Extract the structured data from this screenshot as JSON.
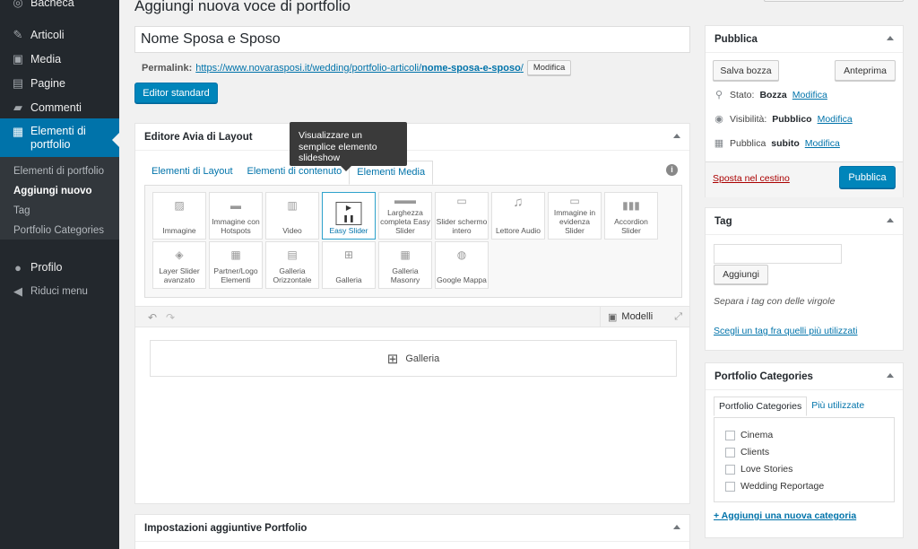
{
  "sidebar": {
    "items": [
      {
        "label": "Bacheca",
        "icon": "dashboard-icon"
      },
      {
        "label": "Articoli",
        "icon": "pin-icon"
      },
      {
        "label": "Media",
        "icon": "media-icon"
      },
      {
        "label": "Pagine",
        "icon": "page-icon"
      },
      {
        "label": "Commenti",
        "icon": "comment-icon"
      },
      {
        "label": "Elementi di portfolio",
        "icon": "portfolio-icon"
      },
      {
        "label": "Profilo",
        "icon": "user-icon"
      },
      {
        "label": "Riduci menu",
        "icon": "collapse-icon"
      }
    ],
    "submenu": [
      "Elementi di portfolio",
      "Aggiungi nuovo",
      "Tag",
      "Portfolio Categories"
    ]
  },
  "page": {
    "title": "Aggiungi nuova voce di portfolio",
    "post_title": "Nome Sposa e Sposo",
    "permalink_label": "Permalink:",
    "permalink_base": "https://www.novarasposi.it/wedding/portfolio-articoli/",
    "permalink_slug": "nome-sposa-e-sposo",
    "permalink_end": "/",
    "modify": "Modifica",
    "editor_standard": "Editor standard"
  },
  "avia": {
    "title": "Editore Avia di Layout",
    "tabs": [
      "Elementi di Layout",
      "Elementi di contenuto",
      "Elementi Media"
    ],
    "tooltip": "Visualizzare un semplice elemento slideshow",
    "elements": [
      "Immagine",
      "Immagine con Hotspots",
      "Video",
      "Easy Slider",
      "Larghezza completa Easy Slider",
      "Slider schermo intero",
      "Lettore Audio",
      "Immagine in evidenza Slider",
      "Accordion Slider",
      "Layer Slider avanzato",
      "Partner/Logo Elementi",
      "Galleria Orizzontale",
      "Galleria",
      "Galleria Masonry",
      "Google Mappa"
    ],
    "templates": "Modelli",
    "canvas_item": "Galleria"
  },
  "extra": {
    "title": "Impostazioni aggiuntive Portfolio"
  },
  "publish": {
    "title": "Pubblica",
    "save_draft": "Salva bozza",
    "preview": "Anteprima",
    "status_label": "Stato:",
    "status_value": "Bozza",
    "visibility_label": "Visibilità:",
    "visibility_value": "Pubblico",
    "publish_label": "Pubblica",
    "publish_value": "subito",
    "edit": "Modifica",
    "trash": "Sposta nel cestino",
    "publish_button": "Pubblica"
  },
  "tag": {
    "title": "Tag",
    "add": "Aggiungi",
    "hint": "Separa i tag con delle virgole",
    "choose": "Scegli un tag fra quelli più utilizzati"
  },
  "categories": {
    "title": "Portfolio Categories",
    "tabs": [
      "Portfolio Categories",
      "Più utilizzate"
    ],
    "items": [
      "Cinema",
      "Clients",
      "Love Stories",
      "Wedding Reportage"
    ],
    "add": "+ Aggiungi una nuova categoria"
  }
}
